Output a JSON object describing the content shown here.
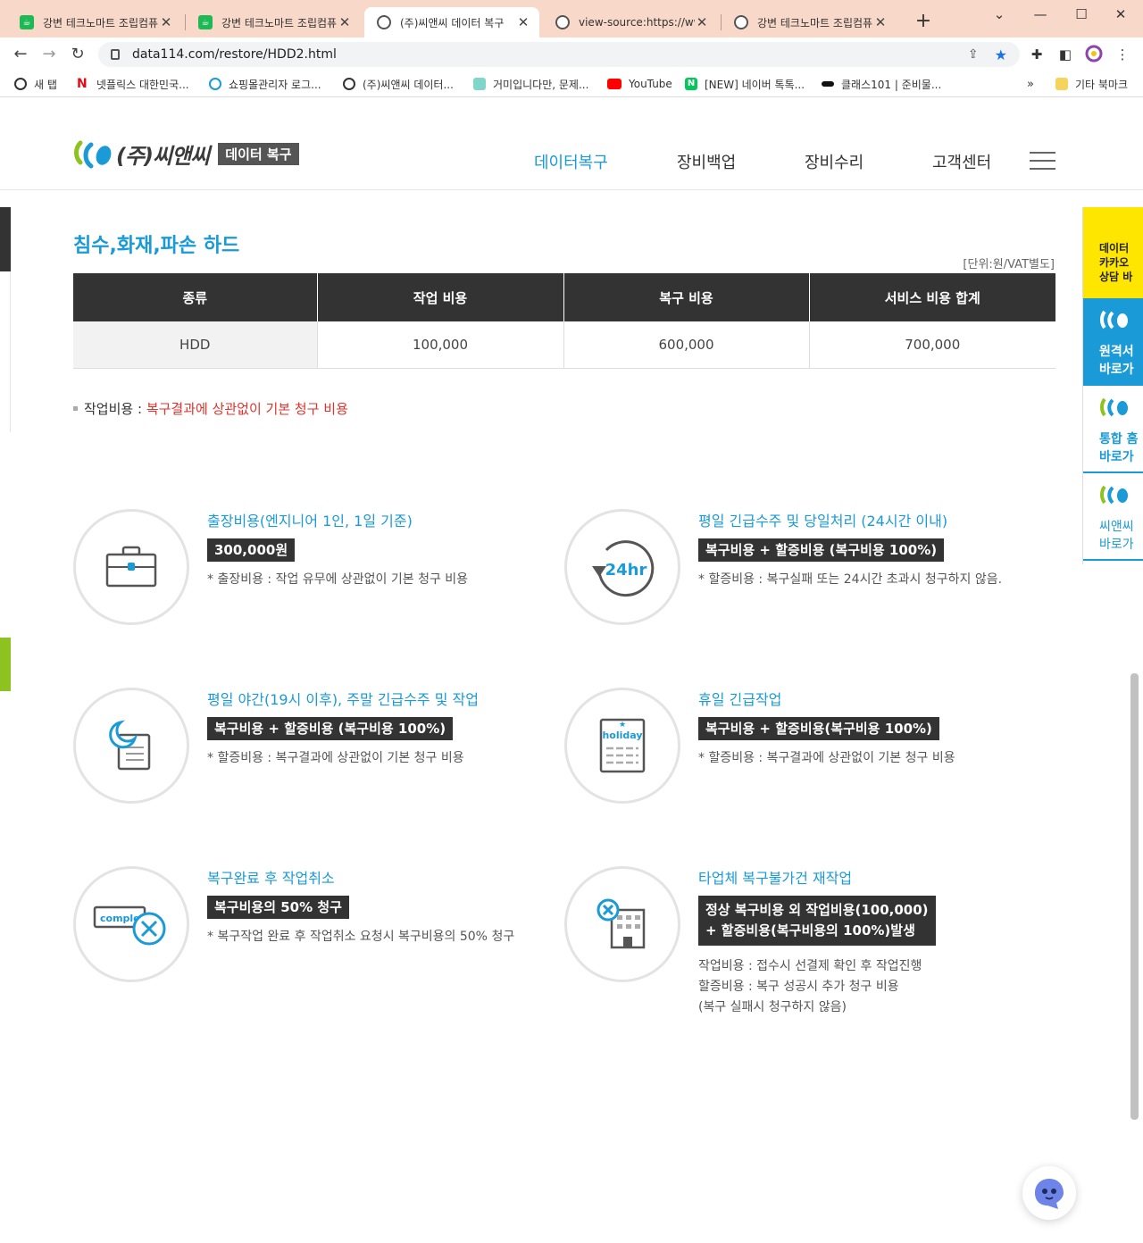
{
  "browser": {
    "tabs": [
      {
        "title": "강변 테크노마트 조립컴퓨"
      },
      {
        "title": "강변 테크노마트 조립컴퓨"
      },
      {
        "title": "(주)씨앤씨 데이터 복구"
      },
      {
        "title": "view-source:https://www"
      },
      {
        "title": "강변 테크노마트 조립컴퓨"
      }
    ],
    "url": "data114.com/restore/HDD2.html",
    "bookmarks": [
      "새 탭",
      "넷플릭스 대한민국...",
      "쇼핑몰관리자 로그...",
      "(주)씨앤씨 데이터...",
      "거미입니다만, 문제...",
      "YouTube",
      "[NEW] 네이버 톡톡...",
      "클래스101 | 준비물...",
      "기타 북마크"
    ]
  },
  "header": {
    "logo_text": "(주)씨앤씨",
    "logo_badge": "데이터 복구",
    "nav": [
      "데이터복구",
      "장비백업",
      "장비수리",
      "고객센터"
    ]
  },
  "section": {
    "title": "침수,화재,파손 하드",
    "unit": "[단위:원/VAT별도]",
    "table": {
      "headers": [
        "종류",
        "작업 비용",
        "복구 비용",
        "서비스 비용 합계"
      ],
      "rows": [
        [
          "HDD",
          "100,000",
          "600,000",
          "700,000"
        ]
      ]
    },
    "note_label": "작업비용 :",
    "note_value": "복구결과에 상관없이 기본 청구 비용"
  },
  "services": [
    {
      "title": "출장비용(엔지니어 1인, 1일 기준)",
      "badge": "300,000원",
      "desc": "* 출장비용 : 작업 유무에 상관없이 기본 청구 비용",
      "icon": "briefcase-icon"
    },
    {
      "title": "평일 긴급수주 및 당일처리 (24시간 이내)",
      "badge": "복구비용 + 할증비용 (복구비용 100%)",
      "desc": "* 할증비용 : 복구실패 또는 24시간 초과시 청구하지 않음.",
      "icon": "24hr-icon",
      "icon_text": "24hr"
    },
    {
      "title": "평일 야간(19시 이후), 주말 긴급수주 및 작업",
      "badge": "복구비용 + 할증비용 (복구비용 100%)",
      "desc": "* 할증비용 : 복구결과에 상관없이 기본 청구 비용",
      "icon": "moon-document-icon"
    },
    {
      "title": "휴일 긴급작업",
      "badge": "복구비용 + 할증비용(복구비용 100%)",
      "desc": "* 할증비용 : 복구결과에 상관없이 기본 청구 비용",
      "icon": "holiday-calendar-icon",
      "icon_text": "holiday"
    },
    {
      "title": "복구완료 후 작업취소",
      "badge": "복구비용의 50% 청구",
      "desc": "* 복구작업 완료 후 작업취소 요청시 복구비용의 50% 청구",
      "icon": "complete-cancel-icon",
      "icon_text": "complet"
    },
    {
      "title": "타업체 복구불가건 재작업",
      "badge_lines": [
        "정상 복구비용 외 작업비용(100,000)",
        "+ 할증비용(복구비용의 100%)발생"
      ],
      "desc_lines": [
        "작업비용 : 접수시 선결제 확인 후 작업진행",
        "할증비용 : 복구 성공시 추가 청구 비용",
        "(복구 실패시 청구하지 않음)"
      ],
      "icon": "building-cancel-icon"
    }
  ],
  "quick_menu": {
    "yellow": [
      "데이터",
      "카카오",
      "상담 바"
    ],
    "blue": [
      "원격서",
      "바로가"
    ],
    "white1": [
      "통합 홈",
      "바로가"
    ],
    "white2": [
      "씨앤씨",
      "바로가"
    ]
  },
  "colors": {
    "accent": "#1a9ad6",
    "dark": "#333333",
    "red": "#e0322b",
    "yellow": "#ffe600",
    "green": "#8dc21f"
  }
}
